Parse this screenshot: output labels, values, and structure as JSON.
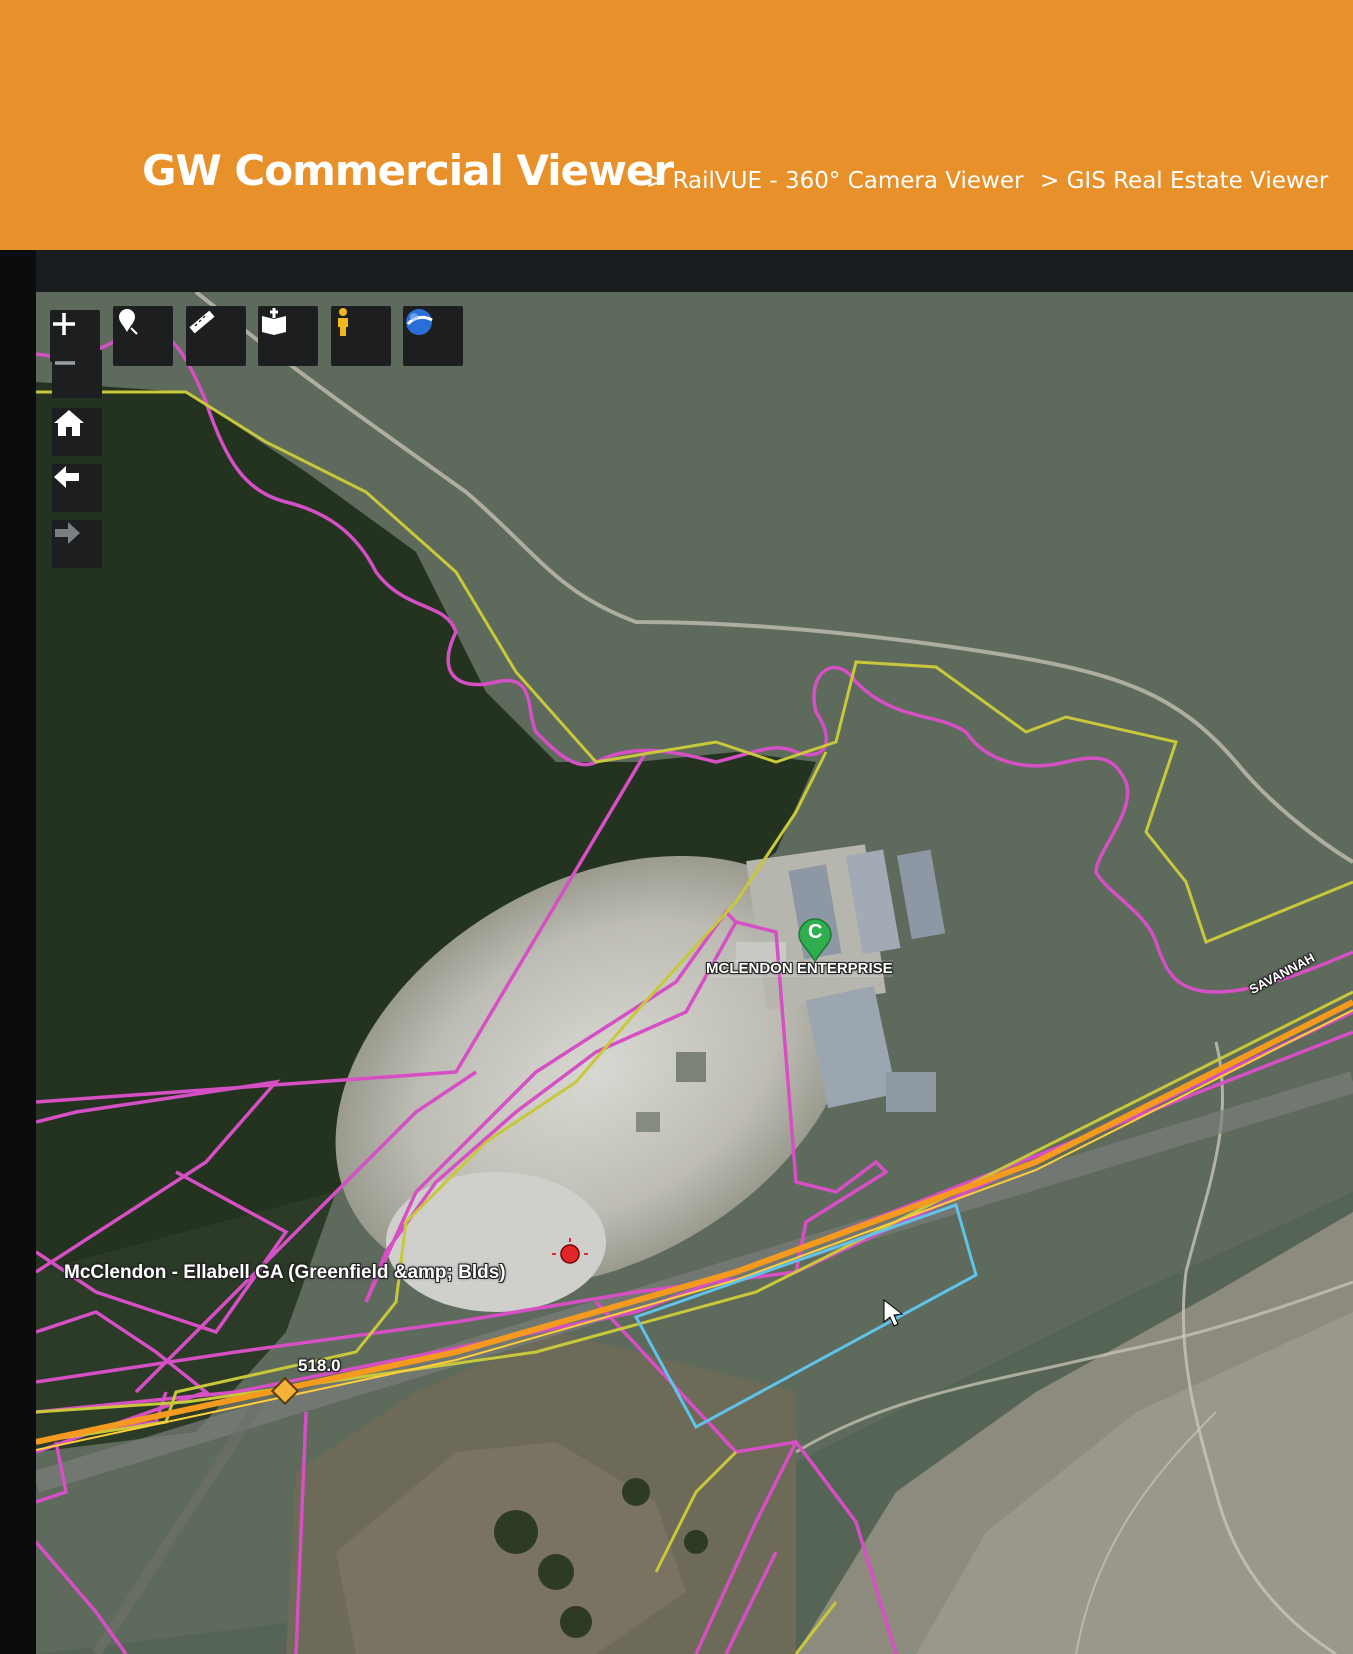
{
  "header": {
    "title": "GW Commercial Viewer",
    "links": [
      "> RailVUE - 360° Camera Viewer",
      "> GIS Real Estate Viewer"
    ],
    "color": "#e8902a"
  },
  "toolbar": {
    "tools": [
      "zoom-in-icon",
      "place-marker-icon",
      "measure-ruler-icon",
      "map-book-icon",
      "street-view-person-icon",
      "google-earth-globe-icon"
    ]
  },
  "nav_controls": [
    "zoom-out-icon",
    "home-icon",
    "back-arrow-icon",
    "forward-arrow-icon"
  ],
  "map": {
    "facility_marker_letter": "C",
    "facility_label": "MCLENDON ENTERPRISE",
    "site_label": "McClendon - Ellabell GA (Greenfield &amp; Blds)",
    "milepost_label": "518.0",
    "railroad_label": "SAVANNAH",
    "colors": {
      "parcel": "#d64fc4",
      "railroad": "#f39a1f",
      "boundary": "#c8c83a",
      "selection": "#5fc3ea"
    }
  }
}
